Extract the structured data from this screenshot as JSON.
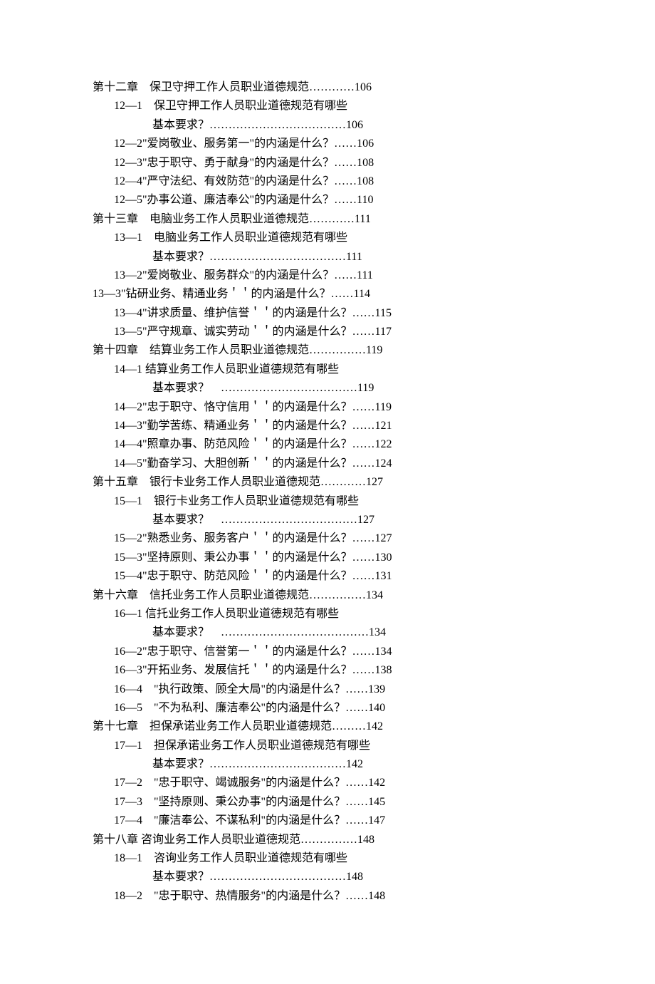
{
  "lines": [
    {
      "cls": "chapter",
      "text": "第十二章　保卫守押工作人员职业道德规范…………106"
    },
    {
      "cls": "entry",
      "text": "12—1　保卫守押工作人员职业道德规范有哪些"
    },
    {
      "cls": "entry-cont",
      "text": "基本要求？………………………………106"
    },
    {
      "cls": "entry",
      "text": "12—2\"爱岗敬业、服务第一\"的内涵是什么？……106"
    },
    {
      "cls": "entry",
      "text": "12—3\"忠于职守、勇于献身\"的内涵是什么？……108"
    },
    {
      "cls": "entry",
      "text": "12—4\"严守法纪、有效防范\"的内涵是什么？……108"
    },
    {
      "cls": "entry",
      "text": "12—5\"办事公道、廉洁奉公\"的内涵是什么？……110"
    },
    {
      "cls": "chapter",
      "text": "第十三章　电脑业务工作人员职业道德规范…………111"
    },
    {
      "cls": "entry",
      "text": "13—1　电脑业务工作人员职业道德规范有哪些"
    },
    {
      "cls": "entry-cont",
      "text": "基本要求？………………………………111"
    },
    {
      "cls": "entry",
      "text": "13—2\"爱岗敬业、服务群众\"的内涵是什么？……111"
    },
    {
      "cls": "entry-special",
      "text": "13—3\"钻研业务、精通业务＇＇的内涵是什么？……114"
    },
    {
      "cls": "entry",
      "text": "13—4\"讲求质量、维护信誉＇＇的内涵是什么？……115"
    },
    {
      "cls": "entry",
      "text": "13—5\"严守规章、诚实劳动＇＇的内涵是什么？……117"
    },
    {
      "cls": "chapter",
      "text": "第十四章　结算业务工作人员职业道德规范……………119"
    },
    {
      "cls": "entry",
      "text": "14—1 结算业务工作人员职业道德规范有哪些"
    },
    {
      "cls": "entry-cont",
      "text": "基本要求？　………………………………119"
    },
    {
      "cls": "entry",
      "text": "14—2\"忠于职守、恪守信用＇＇的内涵是什么？……119"
    },
    {
      "cls": "entry",
      "text": "14—3\"勤学苦练、精通业务＇＇的内涵是什么？……121"
    },
    {
      "cls": "entry",
      "text": "14—4\"照章办事、防范风险＇＇的内涵是什么？……122"
    },
    {
      "cls": "entry",
      "text": "14—5\"勤奋学习、大胆创新＇＇的内涵是什么？……124"
    },
    {
      "cls": "chapter",
      "text": "第十五章　银行卡业务工作人员职业道德规范…………127"
    },
    {
      "cls": "entry",
      "text": "15—1　银行卡业务工作人员职业道德规范有哪些"
    },
    {
      "cls": "entry-cont",
      "text": "基本要求？　………………………………127"
    },
    {
      "cls": "entry",
      "text": "15—2\"熟悉业务、服务客户＇＇的内涵是什么？……127"
    },
    {
      "cls": "entry",
      "text": "15—3\"坚持原则、秉公办事＇＇的内涵是什么？……130"
    },
    {
      "cls": "entry",
      "text": "15—4\"忠于职守、防范风险＇＇的内涵是什么？……131"
    },
    {
      "cls": "chapter",
      "text": "第十六章　信托业务工作人员职业道德规范……………134"
    },
    {
      "cls": "entry",
      "text": "16—1 信托业务工作人员职业道德规范有哪些"
    },
    {
      "cls": "entry-cont",
      "text": "基本要求？　…………………………………134"
    },
    {
      "cls": "entry",
      "text": "16—2\"忠于职守、信誉第一＇＇的内涵是什么？……134"
    },
    {
      "cls": "entry",
      "text": "16—3\"开拓业务、发展信托＇＇的内涵是什么？……138"
    },
    {
      "cls": "entry",
      "text": "16—4　\"执行政策、顾全大局\"的内涵是什么？……139"
    },
    {
      "cls": "entry",
      "text": "16—5　\"不为私利、廉洁奉公\"的内涵是什么？……140"
    },
    {
      "cls": "chapter",
      "text": "第十七章　担保承诺业务工作人员职业道德规范………142"
    },
    {
      "cls": "entry",
      "text": "17—1　担保承诺业务工作人员职业道德规范有哪些"
    },
    {
      "cls": "entry-cont",
      "text": "基本要求？………………………………142"
    },
    {
      "cls": "entry",
      "text": "17—2　\"忠于职守、竭诚服务\"的内涵是什么？……142"
    },
    {
      "cls": "entry",
      "text": "17—3　\"坚持原则、秉公办事\"的内涵是什么？……145"
    },
    {
      "cls": "entry",
      "text": "17—4　\"廉洁奉公、不谋私利\"的内涵是什么？……147"
    },
    {
      "cls": "chapter",
      "text": "第十八章 咨询业务工作人员职业道德规范……………148"
    },
    {
      "cls": "entry",
      "text": "18—1　咨询业务工作人员职业道德规范有哪些"
    },
    {
      "cls": "entry-cont",
      "text": "基本要求？………………………………148"
    },
    {
      "cls": "entry",
      "text": "18—2　\"忠于职守、热情服务\"的内涵是什么？……148"
    }
  ]
}
